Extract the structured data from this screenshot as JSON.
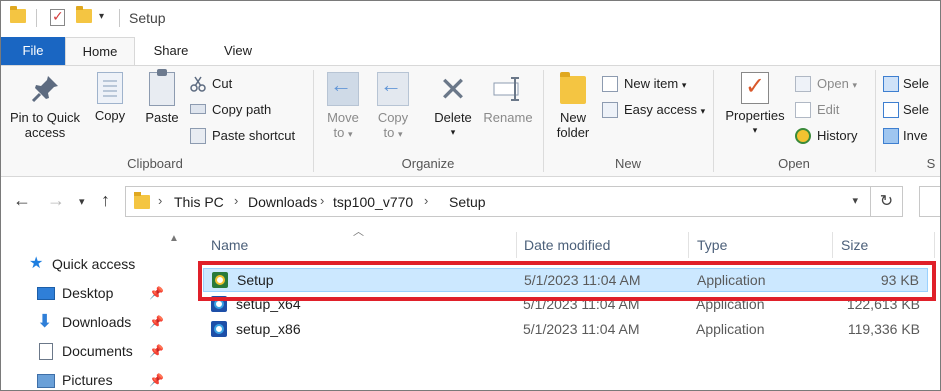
{
  "window": {
    "title": "Setup"
  },
  "tabs": [
    "File",
    "Home",
    "Share",
    "View"
  ],
  "ribbon": {
    "clipboard": {
      "label": "Clipboard",
      "pin_to_quick_access": [
        "Pin to Quick",
        "access"
      ],
      "copy": "Copy",
      "paste": "Paste",
      "cut": "Cut",
      "copy_path": "Copy path",
      "paste_shortcut": "Paste shortcut"
    },
    "organize": {
      "label": "Organize",
      "move_to": [
        "Move",
        "to"
      ],
      "copy_to": [
        "Copy",
        "to"
      ],
      "delete": "Delete",
      "rename": "Rename"
    },
    "new": {
      "label": "New",
      "new_folder": [
        "New",
        "folder"
      ],
      "new_item": "New item",
      "easy_access": "Easy access"
    },
    "open": {
      "label": "Open",
      "properties": "Properties",
      "open": "Open",
      "edit": "Edit",
      "history": "History"
    },
    "select": {
      "label": "S",
      "select_all": "Sele",
      "select_none": "Sele",
      "invert": "Inve"
    }
  },
  "address": {
    "crumbs": [
      "This PC",
      "Downloads",
      "tsp100_v770",
      "Setup"
    ]
  },
  "navpane": {
    "items": [
      {
        "label": "Quick access",
        "icon": "star-icon"
      },
      {
        "label": "Desktop",
        "icon": "desktop-icon",
        "pinned": true
      },
      {
        "label": "Downloads",
        "icon": "downloads-icon",
        "pinned": true
      },
      {
        "label": "Documents",
        "icon": "documents-icon",
        "pinned": true
      },
      {
        "label": "Pictures",
        "icon": "pictures-icon",
        "pinned": true
      }
    ]
  },
  "filelist": {
    "columns": [
      "Name",
      "Date modified",
      "Type",
      "Size"
    ],
    "rows": [
      {
        "name": "Setup",
        "date": "5/1/2023 11:04 AM",
        "type": "Application",
        "size": "93 KB",
        "selected": true
      },
      {
        "name": "setup_x64",
        "date": "5/1/2023 11:04 AM",
        "type": "Application",
        "size": "122,613 KB",
        "selected": false
      },
      {
        "name": "setup_x86",
        "date": "5/1/2023 11:04 AM",
        "type": "Application",
        "size": "119,336 KB",
        "selected": false
      }
    ]
  },
  "colors": {
    "accent": "#1a66c2",
    "selection": "#cce8ff",
    "highlight": "#e0202a"
  }
}
